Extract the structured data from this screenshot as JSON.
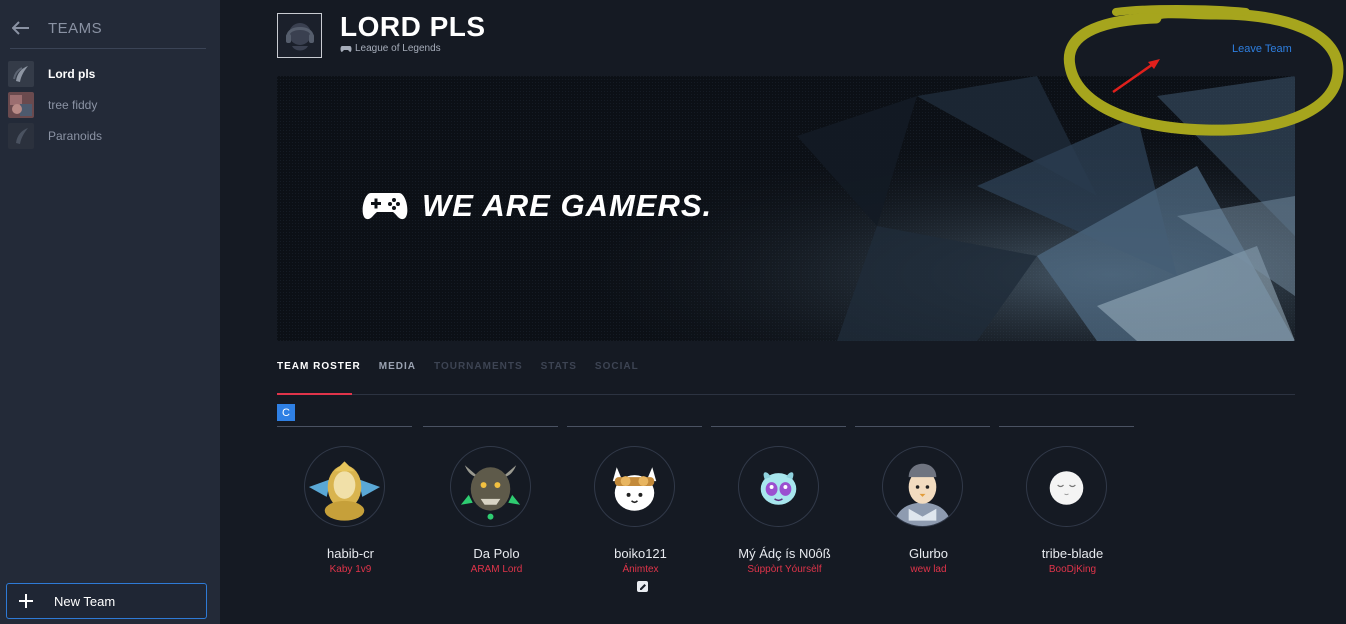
{
  "sidebar": {
    "title": "TEAMS",
    "teams": [
      {
        "name": "Lord pls",
        "active": true
      },
      {
        "name": "tree fiddy",
        "active": false
      },
      {
        "name": "Paranoids",
        "active": false
      }
    ],
    "new_team_label": "New Team"
  },
  "header": {
    "team_name": "LORD PLS",
    "game": "League of Legends",
    "leave_label": "Leave Team"
  },
  "banner": {
    "slogan": "WE ARE GAMERS."
  },
  "tabs": [
    {
      "label": "TEAM ROSTER",
      "state": "active"
    },
    {
      "label": "MEDIA",
      "state": "normal"
    },
    {
      "label": "TOURNAMENTS",
      "state": "disabled"
    },
    {
      "label": "STATS",
      "state": "disabled"
    },
    {
      "label": "SOCIAL",
      "state": "disabled"
    }
  ],
  "roster": {
    "captain_badge": "C",
    "members": [
      {
        "name": "habib-cr",
        "role": "Kaby 1v9",
        "avatar": "golden-helmet-avatar"
      },
      {
        "name": "Da Polo",
        "role": "ARAM Lord",
        "avatar": "horned-demon-avatar"
      },
      {
        "name": "boiko121",
        "role": "Ánimtex",
        "avatar": "cat-goggles-avatar"
      },
      {
        "name": "Mý Ádç ís N0ôß",
        "role": "Súppòrt Yóursèlf",
        "avatar": "purple-creature-avatar"
      },
      {
        "name": "Glurbo",
        "role": "wew lad",
        "avatar": "pigeon-mascot-avatar"
      },
      {
        "name": "tribe-blade",
        "role": "BooDjKing",
        "avatar": "sleepy-face-avatar"
      }
    ]
  },
  "colors": {
    "accent_blue": "#2e7fe0",
    "accent_red": "#e0344a",
    "sidebar_bg": "#232a38",
    "page_bg": "#151a23",
    "annotation_yellow": "#a6a51d",
    "annotation_arrow": "#e0201c"
  }
}
